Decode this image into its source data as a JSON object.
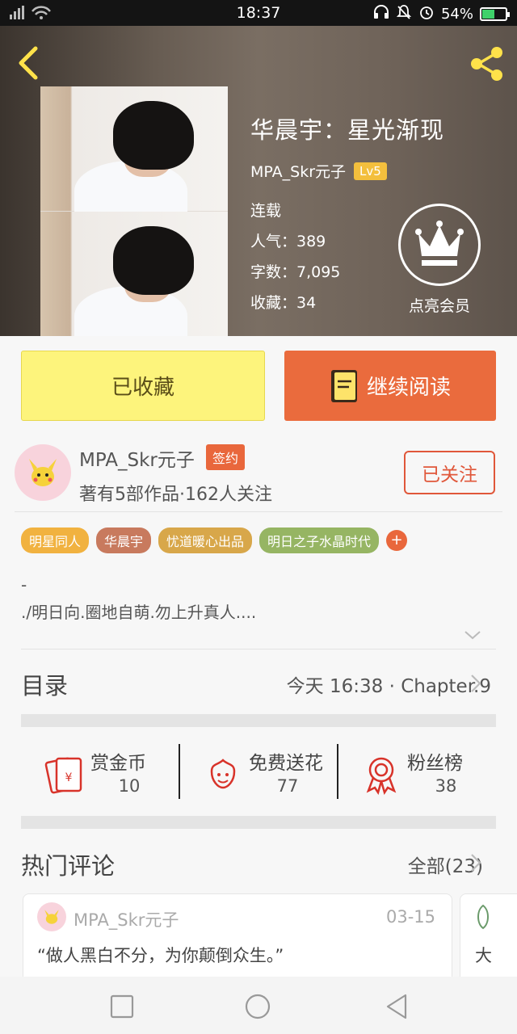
{
  "status_bar": {
    "time": "18:37",
    "battery": "54%",
    "battery_level": 0.54
  },
  "book": {
    "title": "华晨宇：星光渐现",
    "author": "MPA_Skr元子",
    "level": "Lv5",
    "status": "连载",
    "popularity": "人气：389",
    "word_count": "字数：7,095",
    "favorites": "收藏：34",
    "vip_label": "点亮会员"
  },
  "actions": {
    "favorited_label": "已收藏",
    "continue_label": "继续阅读"
  },
  "author_block": {
    "name": "MPA_Skr元子",
    "badge": "签约",
    "subtitle": "著有5部作品·162人关注",
    "follow_label": "已关注"
  },
  "tags": [
    {
      "label": "明星同人",
      "color": "#f1b240"
    },
    {
      "label": "华晨宇",
      "color": "#c87a5e"
    },
    {
      "label": "忧道暖心出品",
      "color": "#d8a74a"
    },
    {
      "label": "明日之子水晶时代",
      "color": "#96b563"
    }
  ],
  "tag_more": "+",
  "intro": {
    "line1": "-",
    "line2": "./明日向.圈地自萌.勿上升真人...."
  },
  "toc": {
    "label": "目录",
    "latest": "今天 16:38 · Chapter.9"
  },
  "stats": [
    {
      "label": "赏金币",
      "value": "10",
      "icon": "red-envelope-icon"
    },
    {
      "label": "免费送花",
      "value": "77",
      "icon": "flower-icon"
    },
    {
      "label": "粉丝榜",
      "value": "38",
      "icon": "medal-icon"
    }
  ],
  "comments": {
    "label": "热门评论",
    "all_label": "全部(23)",
    "items": [
      {
        "user": "MPA_Skr元子",
        "date": "03-15",
        "text": "“做人黑白不分，为你颠倒众生。”"
      },
      {
        "text": "大"
      }
    ]
  },
  "colors": {
    "accent": "#ea6b3d",
    "favorite": "#fdf47c",
    "level_badge": "#f3bf3d"
  }
}
